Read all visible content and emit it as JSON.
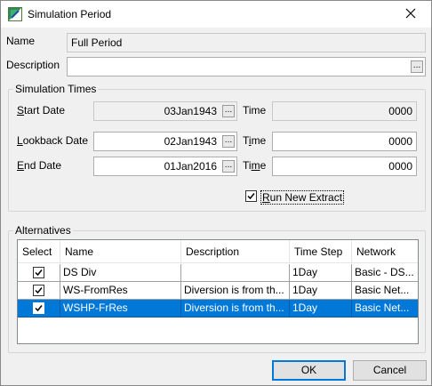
{
  "window": {
    "title": "Simulation Period",
    "icon": "simulation-app-icon",
    "close_icon": "close-icon"
  },
  "form": {
    "name_label": "Name",
    "name_value": "Full Period",
    "description_label": "Description",
    "description_value": ""
  },
  "simulation_times": {
    "group_label": "Simulation Times",
    "start_date_label": "Start Date",
    "start_date_value": "03Jan1943",
    "start_time_label": "Time",
    "start_time_value": "0000",
    "lookback_date_label": "Lookback Date",
    "lookback_date_value": "02Jan1943",
    "lookback_time_label": "Time",
    "lookback_time_value": "0000",
    "end_date_label": "End Date",
    "end_date_value": "01Jan2016",
    "end_time_label": "Time",
    "end_time_value": "0000",
    "run_new_extract_label": "Run New Extract",
    "run_new_extract_checked": true
  },
  "alternatives": {
    "group_label": "Alternatives",
    "columns": [
      "Select",
      "Name",
      "Description",
      "Time Step",
      "Network"
    ],
    "rows": [
      {
        "selected": true,
        "name": "DS Div",
        "description": "",
        "time_step": "1Day",
        "network": "Basic - DS..."
      },
      {
        "selected": true,
        "name": "WS-FromRes",
        "description": "Diversion is from th...",
        "time_step": "1Day",
        "network": "Basic Net..."
      },
      {
        "selected": true,
        "name": "WSHP-FrRes",
        "description": "Diversion is from th...",
        "time_step": "1Day",
        "network": "Basic Net...",
        "highlighted": true
      }
    ]
  },
  "buttons": {
    "ok_label": "OK",
    "cancel_label": "Cancel",
    "ellipsis_label": "..."
  },
  "colors": {
    "selection": "#0078d7",
    "default_button_border": "#0078d7"
  }
}
